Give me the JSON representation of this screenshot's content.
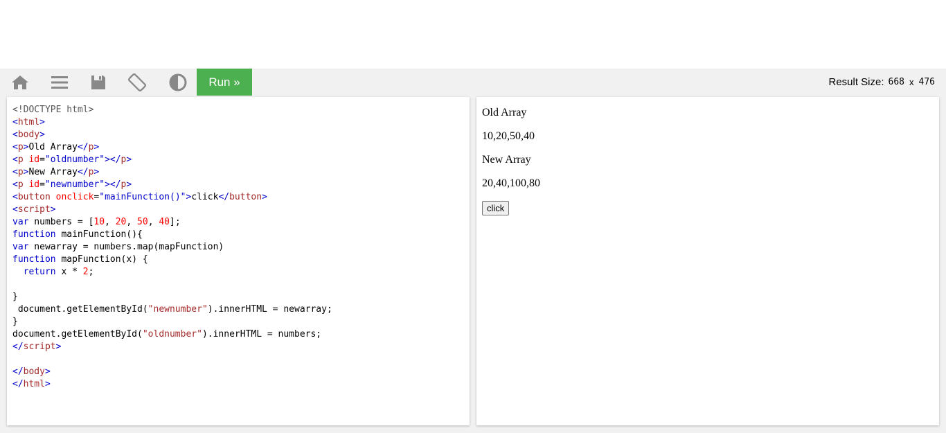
{
  "toolbar": {
    "icons": [
      "home-icon",
      "menu-icon",
      "save-icon",
      "rotate-icon",
      "contrast-icon"
    ],
    "run_label": "Run »",
    "result_size_label": "Result Size:",
    "result_width": "668",
    "result_x": "x",
    "result_height": "476",
    "run_color": "#4caf50"
  },
  "code": {
    "l1": "<!DOCTYPE html>",
    "l2_tag": "html",
    "l3_tag": "body",
    "l4_tag": "p",
    "l4_text": "Old Array",
    "l5_tag": "p",
    "l5_attr": "id",
    "l5_val": "\"oldnumber\"",
    "l6_tag": "p",
    "l6_text": "New Array",
    "l7_tag": "p",
    "l7_attr": "id",
    "l7_val": "\"newnumber\"",
    "l8_tag": "button",
    "l8_attr": "onclick",
    "l8_val": "\"mainFunction()\"",
    "l8_text": "click",
    "l9_tag": "script",
    "l10_kw": "var",
    "l10_a": " numbers = [",
    "l10_n1": "10",
    "l10_n2": "20",
    "l10_n3": "50",
    "l10_n4": "40",
    "l10_b": "];",
    "l11_kw": "function",
    "l11_rest": " mainFunction(){",
    "l12_kw": "var",
    "l12_rest": " newarray = numbers.map(mapFunction)",
    "l13_kw": "function",
    "l13_rest": " mapFunction(x) {",
    "l14_kw": "return",
    "l14_a": " x * ",
    "l14_n": "2",
    "l14_b": ";",
    "l15": "",
    "l16": "}",
    "l17_a": " document.getElementById(",
    "l17_str": "\"newnumber\"",
    "l17_b": ").innerHTML = newarray;",
    "l18": "}",
    "l19_a": "document.getElementById(",
    "l19_str": "\"oldnumber\"",
    "l19_b": ").innerHTML = numbers;",
    "l20_tag": "script",
    "l21": "",
    "l22_tag": "body",
    "l23_tag": "html"
  },
  "result": {
    "old_label": "Old Array",
    "old_value": "10,20,50,40",
    "new_label": "New Array",
    "new_value": "20,40,100,80",
    "button_label": "click"
  }
}
